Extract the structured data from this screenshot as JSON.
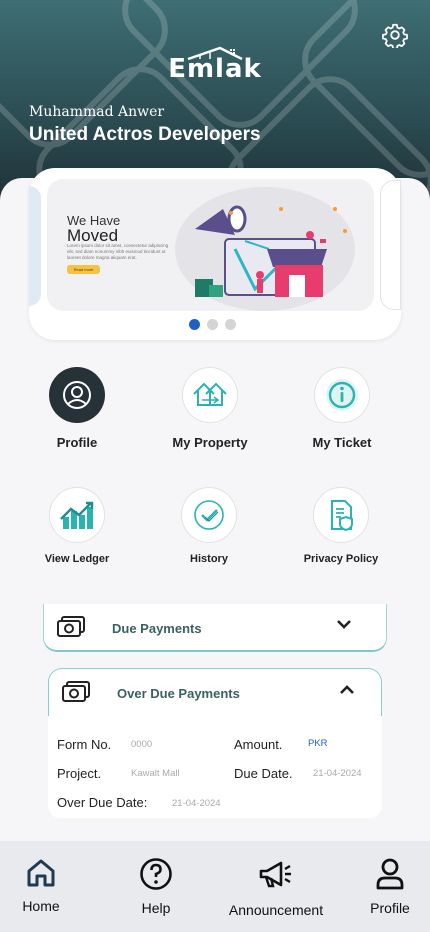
{
  "header": {
    "logo_text": "Emlak",
    "user_name": "Muhammad Anwer",
    "company": "United Actros Developers"
  },
  "banner": {
    "line1": "We Have",
    "line2": "Moved",
    "body": "Lorem ipsum dolor sit amet, consectetur adipiscing elit, sed diam nonummy nibh euismod tincidunt ut laoreet dolore magna aliquam erat.",
    "button": "Read more"
  },
  "carousel": {
    "active_index": 0,
    "dot_count": 3
  },
  "grid": [
    {
      "label": "Profile",
      "icon": "user-circle-icon"
    },
    {
      "label": "My Property",
      "icon": "houses-icon"
    },
    {
      "label": "My Ticket",
      "icon": "info-icon"
    },
    {
      "label": "View Ledger",
      "icon": "chart-growth-icon"
    },
    {
      "label": "History",
      "icon": "check-icon"
    },
    {
      "label": "Privacy Policy",
      "icon": "document-shield-icon"
    }
  ],
  "due_payments": {
    "title": "Due Payments",
    "expanded": false
  },
  "over_due_payments": {
    "title": "Over Due Payments",
    "expanded": true,
    "form_no_label": "Form No.",
    "form_no_value": "0000",
    "amount_label": "Amount.",
    "amount_value": "PKR",
    "project_label": "Project.",
    "project_value": "Kawalt Mall",
    "due_date_label": "Due Date.",
    "due_date_value": "21-04-2024",
    "over_due_date_label": "Over Due Date:",
    "over_due_date_value": "21-04-2024"
  },
  "bottom_nav": [
    {
      "label": "Home",
      "icon": "home-icon"
    },
    {
      "label": "Help",
      "icon": "question-icon"
    },
    {
      "label": "Announcement",
      "icon": "megaphone-icon"
    },
    {
      "label": "Profile",
      "icon": "person-icon"
    }
  ],
  "colors": {
    "header_top": "#3e6e73",
    "header_bottom": "#1f3238",
    "accent_teal": "#2bb3b1",
    "active_dot": "#1f5fc4"
  }
}
